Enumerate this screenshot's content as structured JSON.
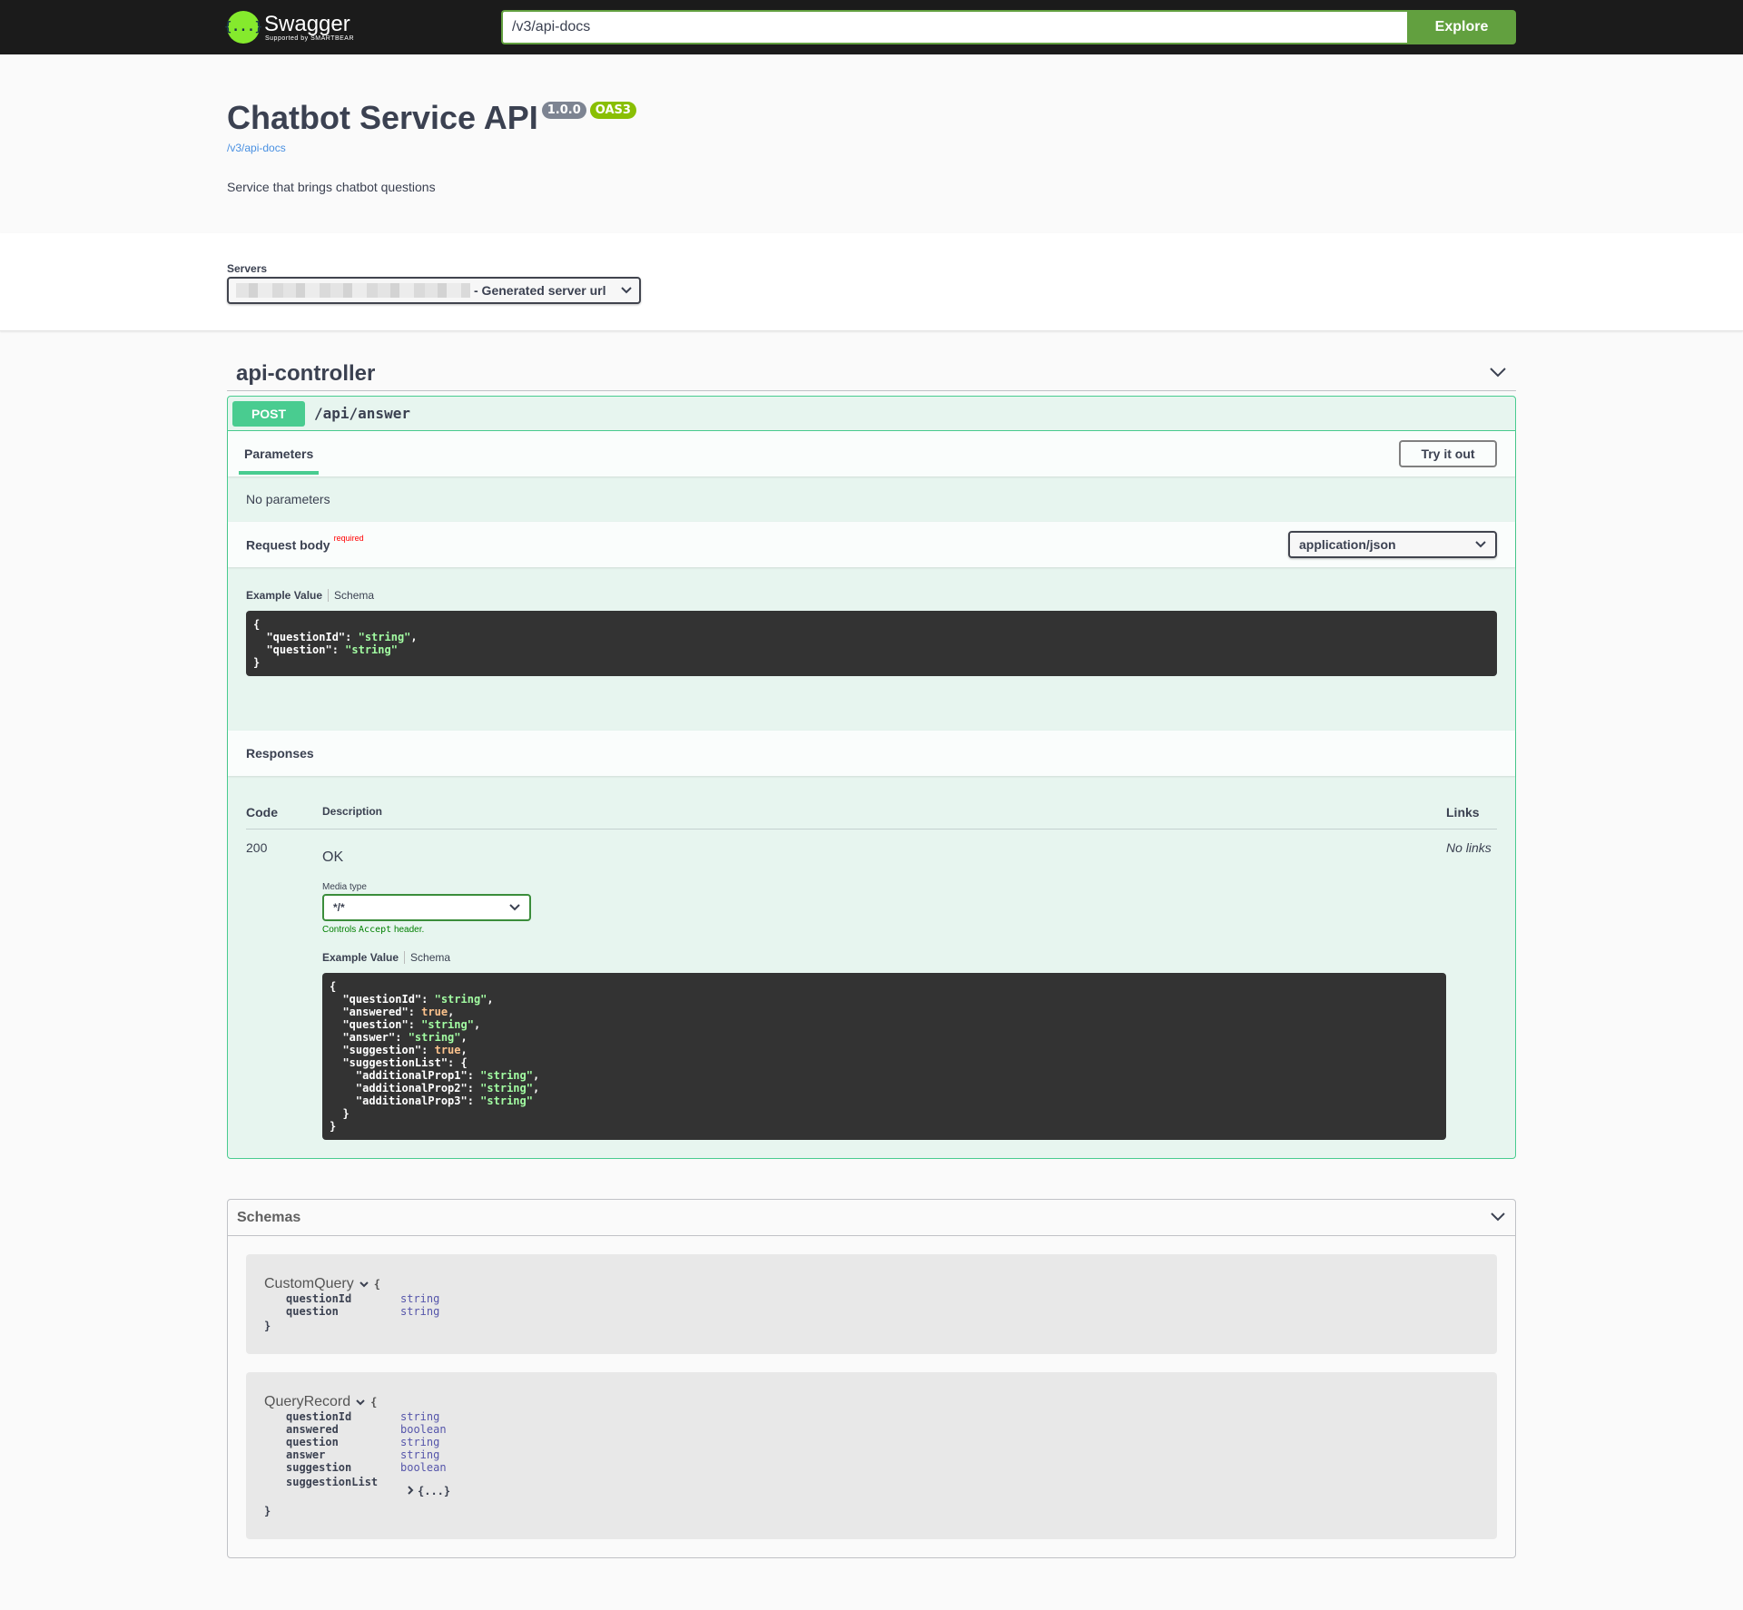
{
  "topbar": {
    "brand": "Swagger",
    "sub": "Supported by SMARTBEAR",
    "logo_glyph": "{...}",
    "url": "/v3/api-docs",
    "explore": "Explore"
  },
  "info": {
    "title": "Chatbot Service API",
    "version": "1.0.0",
    "oas": "OAS3",
    "docs_link": "/v3/api-docs",
    "description": "Service that brings chatbot questions"
  },
  "servers": {
    "label": "Servers",
    "selected_suffix": "- Generated server url"
  },
  "tag": {
    "name": "api-controller"
  },
  "operation": {
    "method": "POST",
    "path": "/api/answer",
    "parameters_tab": "Parameters",
    "try_it_out": "Try it out",
    "no_parameters": "No parameters",
    "request_body": "Request body",
    "required": "required",
    "content_type": "application/json",
    "example_value": "Example Value",
    "schema": "Schema",
    "request_example": [
      "{",
      "  \"questionId\": \"string\",",
      "  \"question\": \"string\"",
      "}"
    ],
    "responses": "Responses",
    "col_code": "Code",
    "col_description": "Description",
    "col_links": "Links",
    "response": {
      "code": "200",
      "description": "OK",
      "media_type_label": "Media type",
      "media_type": "*/*",
      "controls_prefix": "Controls",
      "controls_code": "Accept",
      "controls_suffix": "header.",
      "no_links": "No links"
    }
  },
  "schemas": {
    "title": "Schemas",
    "models": [
      {
        "name": "CustomQuery",
        "props": [
          {
            "name": "questionId",
            "type": "string"
          },
          {
            "name": "question",
            "type": "string"
          }
        ]
      },
      {
        "name": "QueryRecord",
        "props": [
          {
            "name": "questionId",
            "type": "string"
          },
          {
            "name": "answered",
            "type": "boolean"
          },
          {
            "name": "question",
            "type": "string"
          },
          {
            "name": "answer",
            "type": "string"
          },
          {
            "name": "suggestion",
            "type": "boolean"
          },
          {
            "name": "suggestionList",
            "type": "{...}"
          }
        ]
      }
    ]
  },
  "colors": {
    "post": "#49cc90",
    "explore": "#62a03f",
    "topbar": "#1b1b1b"
  }
}
